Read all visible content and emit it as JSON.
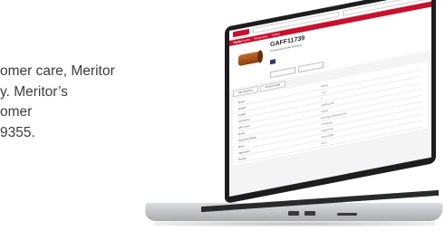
{
  "background_text": {
    "line1": "omer care, Meritor",
    "line2": "y. Meritor’s",
    "line3": "omer",
    "line4": "9355."
  },
  "site": {
    "logo_text": "Meritor",
    "nav_items": [
      "Tractor Trucks",
      "Heavy-duty",
      "Trailers"
    ]
  },
  "product": {
    "title": "GAFF11739",
    "subtitle": "Crankcase Brake Bushing",
    "tabs": [
      "Specifications",
      "Product Detail"
    ]
  },
  "specs": [
    {
      "k": "Brand",
      "v": "Meritor"
    },
    {
      "k": "Weight",
      "v": "1 Lb"
    },
    {
      "k": "Length",
      "v": "3"
    },
    {
      "k": "Unit Name",
      "v": "GAFF11739"
    },
    {
      "k": "UPC Code",
      "v": "Meritor"
    },
    {
      "k": "Model",
      "v": "Bushings & Bushing Kits"
    },
    {
      "k": "Operating Range",
      "v": "Crankcase"
    },
    {
      "k": "Make",
      "v": "Suspension"
    },
    {
      "k": "Application",
      "v": "Model 2000"
    },
    {
      "k": "Product",
      "v": "4.5 in"
    }
  ],
  "colors": {
    "brand": "#c8102e",
    "badge": "#2c3e72"
  }
}
